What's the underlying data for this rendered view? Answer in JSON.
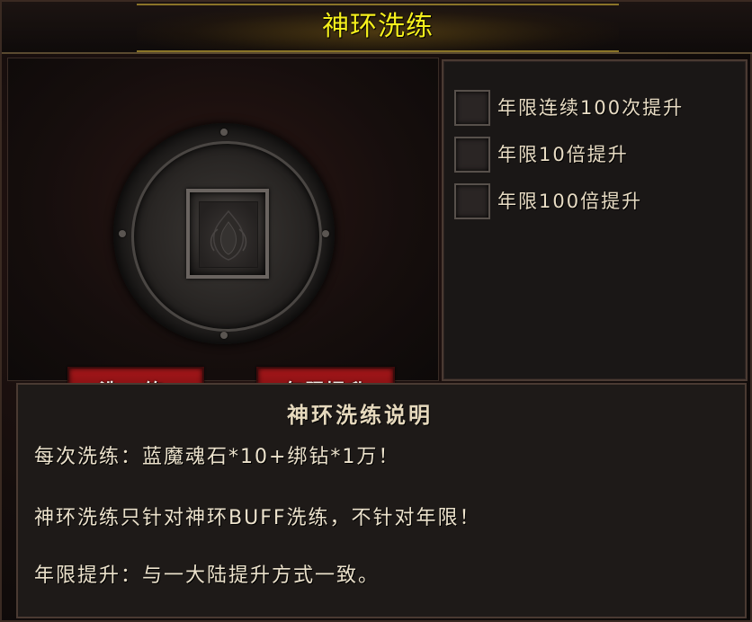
{
  "window": {
    "title": "神环洗练"
  },
  "buttons": {
    "refine": "洗 练",
    "upgrade": "年限提升"
  },
  "options": [
    {
      "label": "年限连续100次提升",
      "checked": false
    },
    {
      "label": "年限10倍提升",
      "checked": false
    },
    {
      "label": "年限100倍提升",
      "checked": false
    }
  ],
  "description": {
    "title": "神环洗练说明",
    "lines": [
      "每次洗练：蓝魔魂石*10+绑钻*1万！",
      "神环洗练只针对神环BUFF洗练，不针对年限！",
      "年限提升：与一大陆提升方式一致。"
    ]
  },
  "colors": {
    "title": "#f5ef1c",
    "button": "#8a1214",
    "text": "#ece2cc"
  },
  "icons": {
    "slot": "empty-item-slot-icon",
    "disc": "ornate-disc-icon"
  }
}
